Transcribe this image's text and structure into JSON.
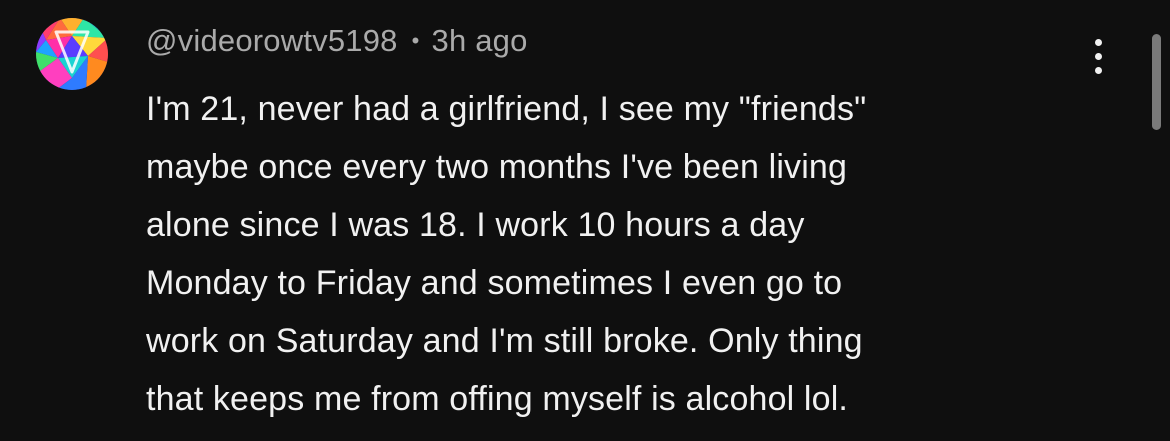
{
  "comment": {
    "author_handle": "@videorowtv5198",
    "separator": "•",
    "timestamp": "3h ago",
    "text_lines": [
      "I'm 21, never had a girlfriend, I see my \"friends\"",
      "maybe once every two months I've been living",
      "alone since I was 18. I work 10 hours a day",
      "Monday to Friday and sometimes I even go to",
      "work on Saturday and I'm still broke. Only thing",
      "that keeps me from offing myself is alcohol lol."
    ],
    "avatar_icon": "colorful-triangle-logo-icon",
    "menu_icon": "more-vertical-icon"
  },
  "colors": {
    "background": "#0f0f0f",
    "primary_text": "#f1f1f1",
    "secondary_text": "#aaaaaa",
    "scrollbar": "#7a7a7a"
  }
}
